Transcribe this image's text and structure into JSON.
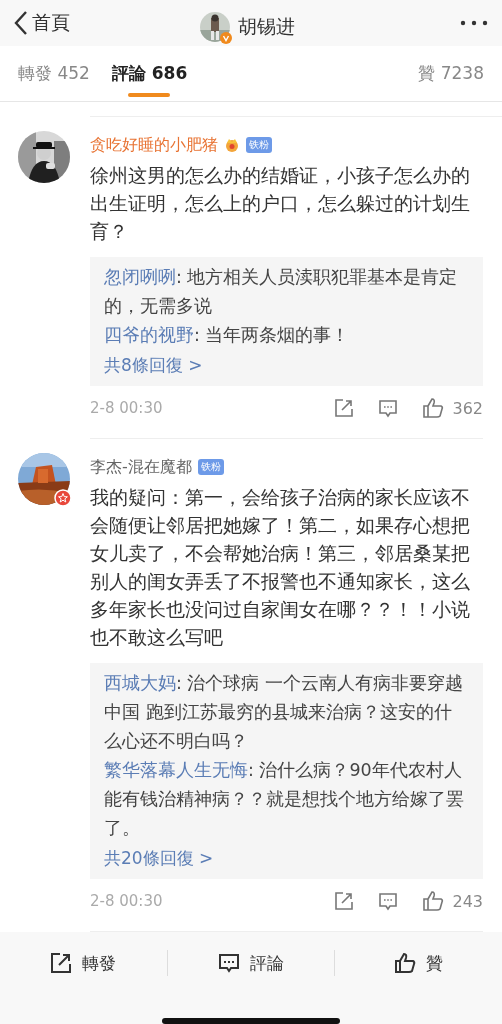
{
  "header": {
    "back_label": "首頁",
    "title": "胡锡进",
    "verified": true
  },
  "tabs": [
    {
      "label": "轉發 452",
      "selected": false
    },
    {
      "label": "評論 686",
      "selected": true
    },
    {
      "label": "贊 7238",
      "selected": false
    }
  ],
  "comments": [
    {
      "author": "贪吃好睡的小肥猪",
      "vip": true,
      "badge": "铁粉",
      "verified": false,
      "text": "徐州这男的怎么办的结婚证，小孩子怎么办的出生证明，怎么上的户口，怎么躲过的计划生育？",
      "replies": [
        {
          "author": "忽闭咧咧",
          "text": ": 地方相关人员渎职犯罪基本是肯定的，无需多说"
        },
        {
          "author": "四爷的视野",
          "text": ": 当年两条烟的事！"
        }
      ],
      "more_replies": "共8條回復 >",
      "time": "2-8 00:30",
      "likes": "362"
    },
    {
      "author": "李杰-混在魔都",
      "vip": false,
      "badge": "铁粉",
      "verified": true,
      "text": "我的疑问：第一，会给孩子治病的家长应该不会随便让邻居把她嫁了！第二，如果存心想把女儿卖了，不会帮她治病！第三，邻居桑某把别人的闺女弄丢了不报警也不通知家长，这么多年家长也没问过自家闺女在哪？？！！小说也不敢这么写吧",
      "replies": [
        {
          "author": "西城大妈",
          "text": ": 治个球病 一个云南人有病非要穿越中国 跑到江苏最穷的县城来治病？这安的什么心还不明白吗？"
        },
        {
          "author": "繁华落幕人生无悔",
          "text": ": 治什么病？90年代农村人能有钱治精神病？？就是想找个地方给嫁了罢了。"
        }
      ],
      "more_replies": "共20條回復 >",
      "time": "2-8 00:30",
      "likes": "243"
    }
  ],
  "actions": [
    {
      "kind": "share",
      "label": "轉發"
    },
    {
      "kind": "comment",
      "label": "評論"
    },
    {
      "kind": "like",
      "label": "贊"
    }
  ]
}
